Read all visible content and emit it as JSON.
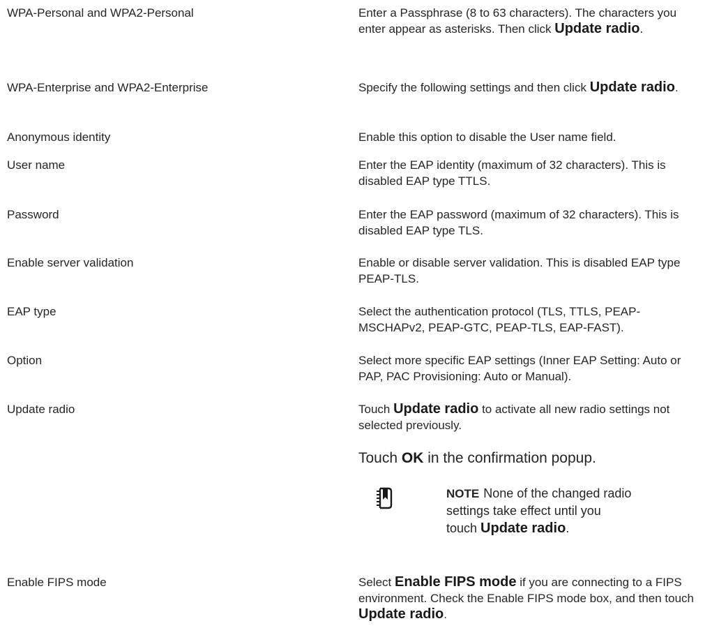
{
  "rows": [
    {
      "term": "WPA-Personal and WPA2-Personal",
      "desc_before": "Enter a Passphrase (8 to 63 characters). The characters you enter appear as asterisks. Then click ",
      "desc_bold": "Update radio",
      "desc_after": "."
    },
    {
      "term": "WPA-Enterprise and WPA2-Enterprise",
      "desc_before": "Specify the following settings and then click ",
      "desc_bold": "Update radio",
      "desc_after": "."
    },
    {
      "term": "Anonymous identity",
      "desc": "Enable this option to disable the User name field."
    },
    {
      "term": "User name",
      "desc": "Enter the EAP identity (maximum of 32 characters). This is disabled EAP type TTLS."
    },
    {
      "term": "Password",
      "desc": "Enter the EAP password (maximum of 32 characters). This is disabled EAP type TLS."
    },
    {
      "term": "Enable server validation",
      "desc": "Enable or disable server validation. This is disabled EAP type PEAP-TLS."
    },
    {
      "term": "EAP type",
      "desc": "Select the authentication protocol (TLS, TTLS, PEAP-MSCHAPv2, PEAP-GTC, PEAP-TLS, EAP-FAST)."
    },
    {
      "term": "Option",
      "desc": "Select more specific EAP settings (Inner EAP Setting: Auto or PAP, PAC Provisioning: Auto or Manual)."
    },
    {
      "term": "Update radio",
      "desc_prefix": "Touch ",
      "desc_bold": "Update radio",
      "desc_suffix": " to activate all new radio settings not selected previously.",
      "desc2_prefix": "Touch ",
      "desc2_bold": "OK",
      "desc2_suffix": " in the confirmation popup."
    },
    {
      "term": "Enable FIPS mode",
      "desc_prefix": "Select ",
      "desc_bold": "Enable FIPS mode",
      "desc_mid": " if you are connecting to a FIPS environment. Check the Enable FIPS mode box, and then touch ",
      "desc_bold2": "Update radio",
      "desc_suffix": "."
    }
  ],
  "note": {
    "icon": "manual-book-icon",
    "label": "NOTE",
    "text": "None of the changed radio settings take effect until you touch ",
    "bold": "Update radio",
    "end": "."
  }
}
